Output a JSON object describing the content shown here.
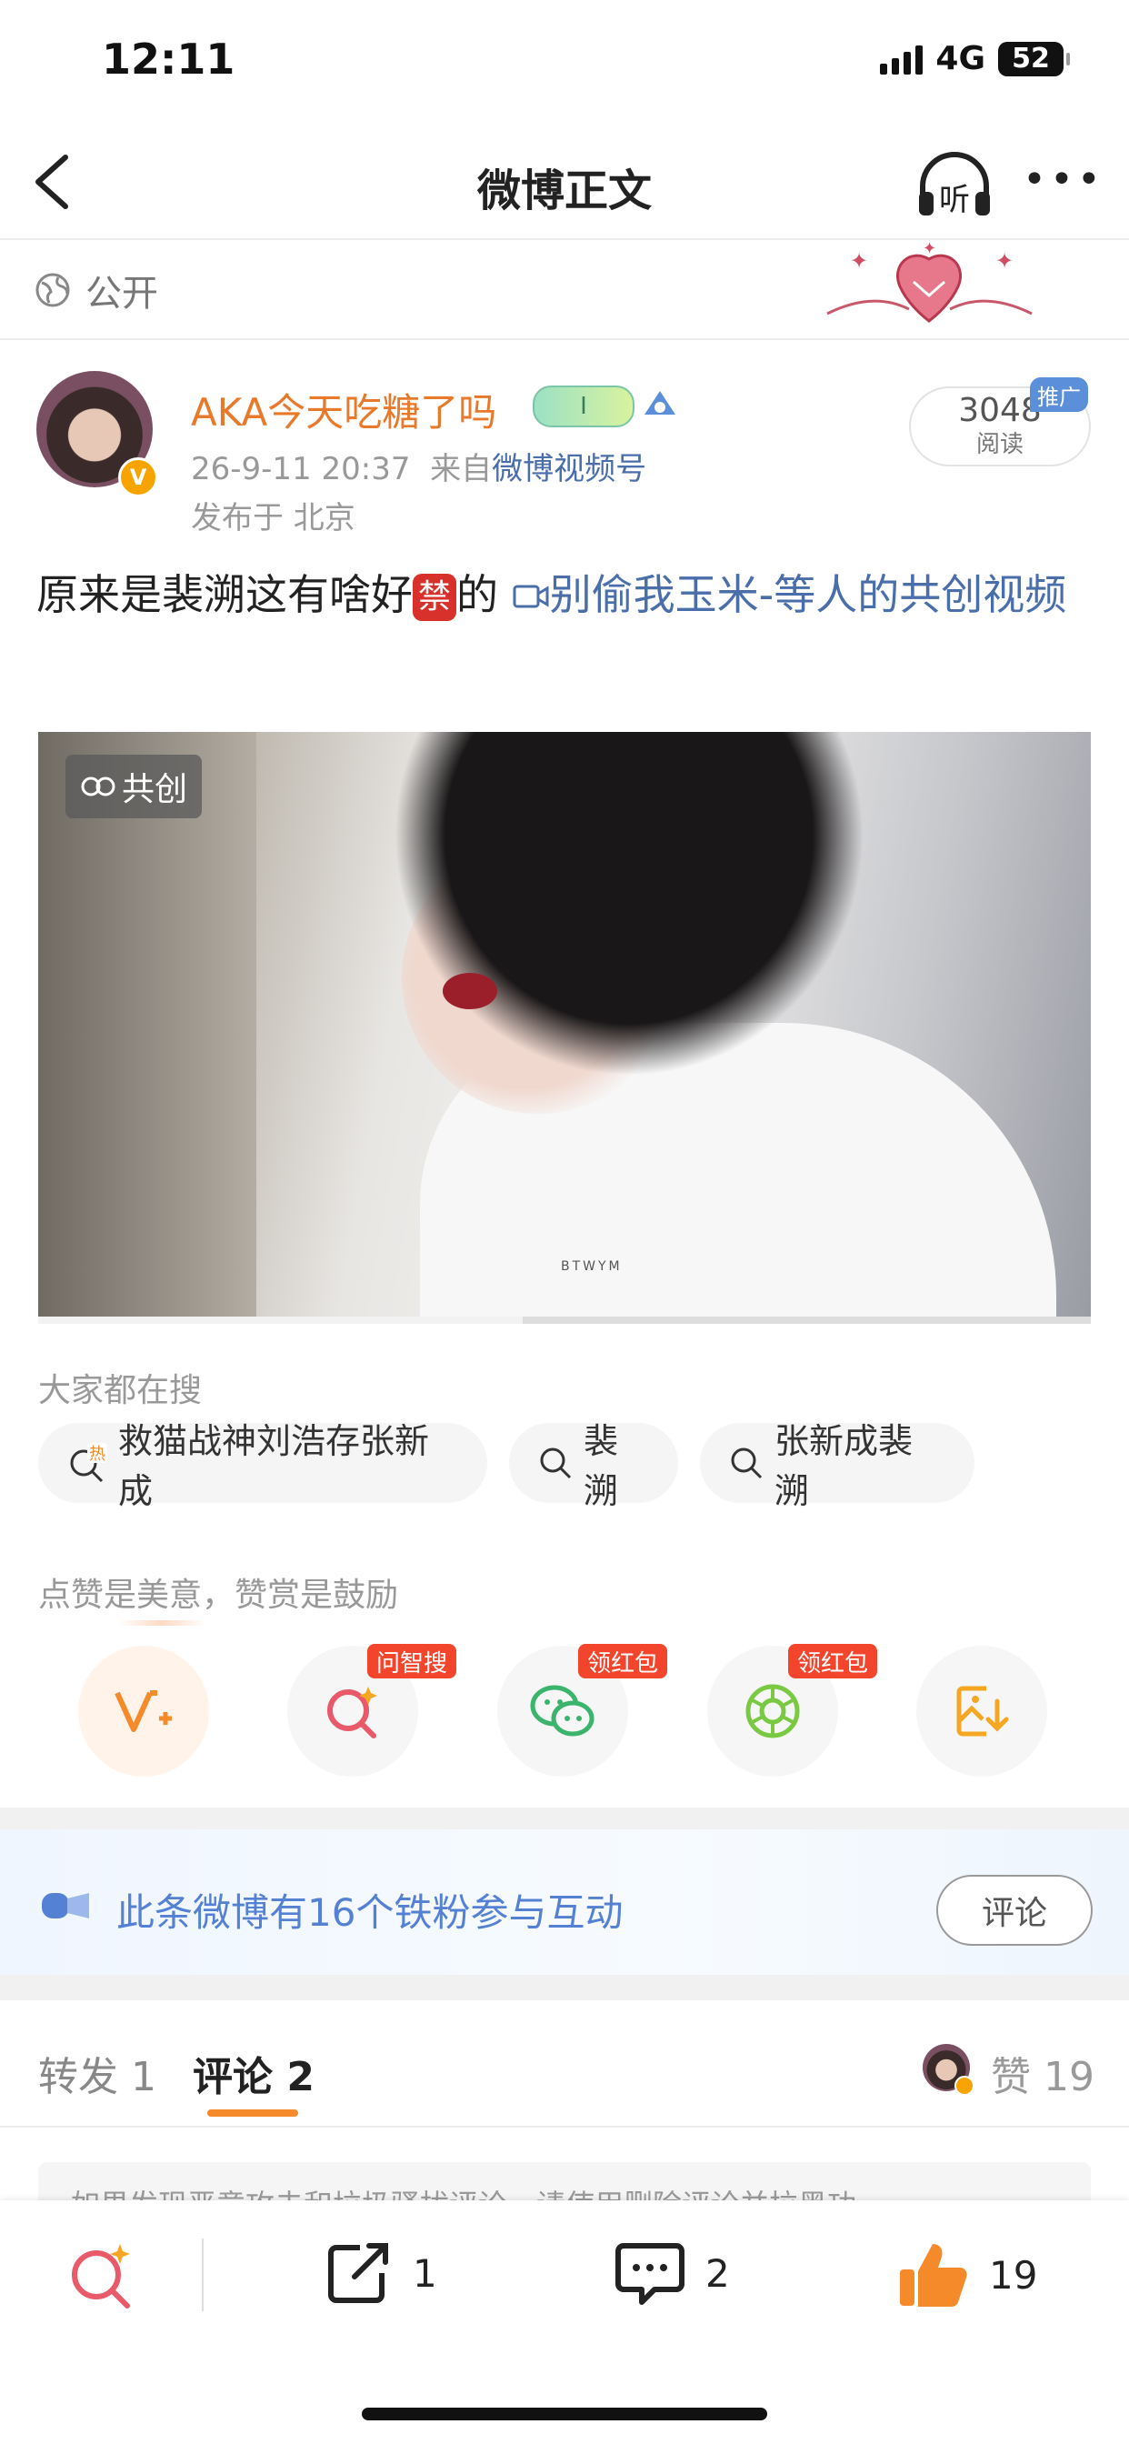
{
  "status": {
    "time": "12:11",
    "network": "4G",
    "battery": "52"
  },
  "nav": {
    "title": "微博正文",
    "listen_label": "听"
  },
  "visibility": {
    "label": "公开"
  },
  "post": {
    "author": "AKA今天吃糖了吗",
    "level_badge": "I",
    "time": "26-9-11 20:37",
    "source_prefix": "来自",
    "source": "微博视频号",
    "location": "发布于 北京",
    "reads_count": "3048",
    "reads_label": "阅读",
    "promo": "推广",
    "text_before": "原来是裴溯这有啥好",
    "text_ban": "禁",
    "text_after": "的 ",
    "video_link": "别偷我玉米-等人的共创视频",
    "cocreate_label": "共创",
    "video_watermark": "BTWYM",
    "video_progress": 0.46
  },
  "search": {
    "label": "大家都在搜",
    "hot_tag": "热",
    "items": [
      "救猫战神刘浩存张新成",
      "裴溯",
      "张新成裴溯"
    ]
  },
  "reward": {
    "label": "点赞是美意，赞赏是鼓励",
    "actions": [
      {
        "icon": "reward-v-icon",
        "tag": ""
      },
      {
        "icon": "smart-search-icon",
        "tag": "问智搜"
      },
      {
        "icon": "wechat-icon",
        "tag": "领红包"
      },
      {
        "icon": "moments-icon",
        "tag": "领红包"
      },
      {
        "icon": "save-image-icon",
        "tag": ""
      }
    ]
  },
  "fans": {
    "text": "此条微博有16个铁粉参与互动",
    "button": "评论"
  },
  "tabs": {
    "repost_label": "转发",
    "repost_count": "1",
    "comment_label": "评论",
    "comment_count": "2",
    "like_label": "赞",
    "like_count": "19"
  },
  "notice": "如果发现恶意攻击和垃圾骚扰评论，请使用删除评论并拉黑功",
  "bottom_bar": {
    "repost": "1",
    "comment": "2",
    "like": "19"
  },
  "colors": {
    "accent": "#f58a2a",
    "link": "#4a6ea9",
    "name": "#e8792a"
  }
}
